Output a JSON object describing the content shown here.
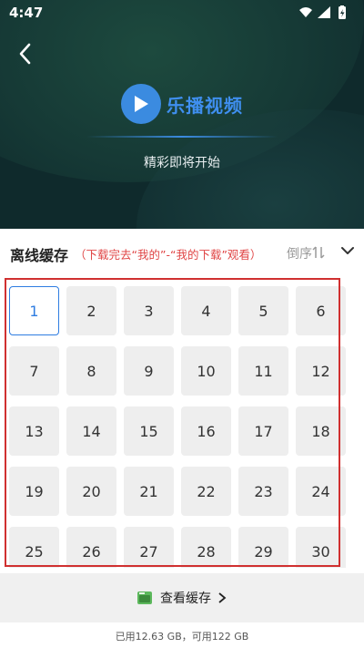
{
  "status_bar": {
    "time": "4:47"
  },
  "player": {
    "logo_text": "乐播视频",
    "tagline": "精彩即将开始"
  },
  "section": {
    "title": "离线缓存",
    "hint": "（下载完去“我的”-“我的下载”观看）",
    "sort_label": "倒序"
  },
  "episodes": [
    "1",
    "2",
    "3",
    "4",
    "5",
    "6",
    "7",
    "8",
    "9",
    "10",
    "11",
    "12",
    "13",
    "14",
    "15",
    "16",
    "17",
    "18",
    "19",
    "20",
    "21",
    "22",
    "23",
    "24",
    "25",
    "26",
    "27",
    "28",
    "29",
    "30"
  ],
  "selected_episode": "1",
  "bottom": {
    "view_cache_label": "查看缓存",
    "storage_text": "已用12.63 GB，可用122 GB"
  },
  "colors": {
    "accent": "#2f7de1",
    "hint_red": "#e04646",
    "highlight_box": "#d03030",
    "player_bg": "#0f2a2c"
  },
  "icons": {
    "back": "chevron-left-icon",
    "logo": "play-icon",
    "sort": "sort-arrows-icon",
    "expand": "chevron-down-icon",
    "cache": "folder-icon",
    "more": "chevron-right-icon"
  }
}
